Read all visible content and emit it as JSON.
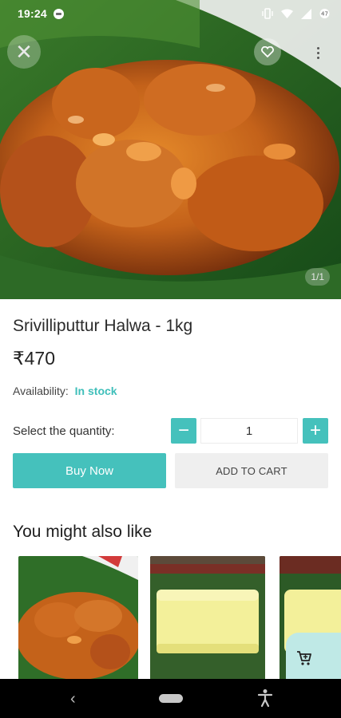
{
  "status_bar": {
    "time": "19:24"
  },
  "hero": {
    "image_counter": "1/1",
    "close_icon": "close-icon",
    "favorite_icon": "heart-icon",
    "more_icon": "more-vertical-icon"
  },
  "product": {
    "title": "Srivilliputtur Halwa - 1kg",
    "price": "₹470",
    "availability_label": "Availability:",
    "availability_value": "In stock",
    "quantity_label": "Select the quantity:",
    "quantity_value": "1",
    "minus_symbol": "−",
    "plus_symbol": "+"
  },
  "actions": {
    "buy_now": "Buy Now",
    "add_to_cart": "ADD TO CART"
  },
  "recommendations": {
    "title": "You might also like"
  },
  "nav": {
    "back_symbol": "‹"
  },
  "colors": {
    "accent": "#45c1bc",
    "in_stock": "#3fbfba",
    "cart_fab": "#bfe9e6"
  }
}
